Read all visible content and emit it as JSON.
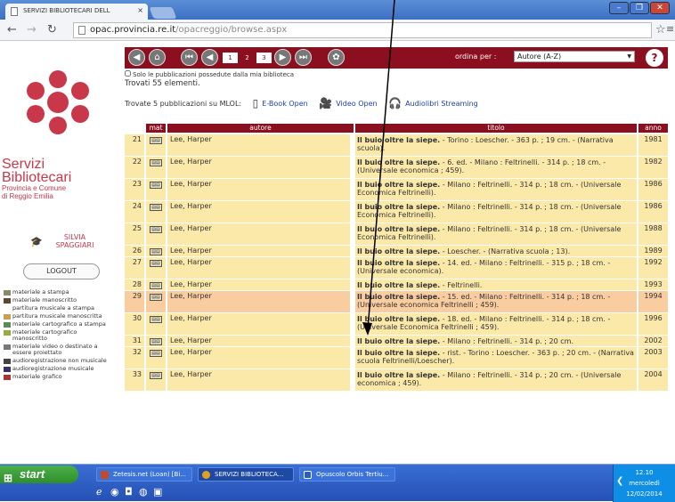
{
  "browser": {
    "tab_title": "SERVIZI BIBLIOTECARI DELL",
    "tab_close": "×",
    "url_host": "opac.provincia.re.it",
    "url_path": "/opacreggio/browse.aspx",
    "win_buttons": [
      "–",
      "❐",
      "✕"
    ]
  },
  "brand": {
    "line1": "Servizi",
    "line2": "Bibliotecari",
    "line3": "Provincia e Comune",
    "line4": "di Reggio Emilia"
  },
  "user": {
    "name1": "SILVIA",
    "name2": "SPAGGIARI",
    "logout": "LOGOUT"
  },
  "legend": [
    "materiale a stampa",
    "materiale manoscritto",
    "partitura musicale a stampa",
    "partitura musicale manoscritta",
    "materiale cartografico a stampa",
    "materiale cartografico manoscritto",
    "materiale video o destinato a essere proiettato",
    "audioregistrazione non musicale",
    "audioregistrazione musicale",
    "materiale grafico"
  ],
  "toolbar": {
    "pages": [
      "1",
      "2",
      "3"
    ],
    "current_page": "2",
    "order_label": "ordina per :",
    "order_value": "Autore (A-Z)",
    "help": "?"
  },
  "filter_text": "Solo le pubblicazioni possedute dalla mia biblioteca",
  "found_text": "Trovati 55 elementi.",
  "mlol": {
    "label": "Trovate 5 pubblicazioni su MLOL:",
    "ebook": "E-Book Open",
    "video": "Video Open",
    "audio": "Audiolibri Streaming"
  },
  "table": {
    "headers": {
      "mat": "mat",
      "autore": "autore",
      "titolo": "titolo",
      "anno": "anno"
    },
    "rows": [
      {
        "n": "21",
        "autore": "Lee, Harper",
        "titolo_b": "Il buio oltre la siepe.",
        "titolo_r": " - Torino : Loescher. - 363 p. ; 19 cm. - (Narrativa scuola).",
        "anno": "1981"
      },
      {
        "n": "22",
        "autore": "Lee, Harper",
        "titolo_b": "Il buio oltre la siepe.",
        "titolo_r": " - 6. ed. - Milano : Feltrinelli. - 314 p. ; 18 cm. - (Universale economica ; 459).",
        "anno": "1982"
      },
      {
        "n": "23",
        "autore": "Lee, Harper",
        "titolo_b": "Il buio oltre la siepe.",
        "titolo_r": " - Milano : Feltrinelli. - 314 p. ; 18 cm. - (Universale Economica Feltrinelli).",
        "anno": "1986"
      },
      {
        "n": "24",
        "autore": "Lee, Harper",
        "titolo_b": "Il buio oltre la siepe.",
        "titolo_r": " - Milano : Feltrinelli. - 314 p. ; 18 cm. - (Universale Economica Feltrinelli).",
        "anno": "1986"
      },
      {
        "n": "25",
        "autore": "Lee, Harper",
        "titolo_b": "Il buio oltre la siepe.",
        "titolo_r": " - Milano : Feltrinelli. - 314 p. ; 18 cm. - (Universale Economica Feltrinelli).",
        "anno": "1988"
      },
      {
        "n": "26",
        "autore": "Lee, Harper",
        "titolo_b": "Il buio oltre la siepe.",
        "titolo_r": " - Loescher. - (Narrativa scuola ; 13).",
        "anno": "1989"
      },
      {
        "n": "27",
        "autore": "Lee, Harper",
        "titolo_b": "Il buio oltre la siepe.",
        "titolo_r": " - 14. ed. - Milano : Feltrinelli. - 315 p. ; 18 cm. - (Universale economica).",
        "anno": "1992"
      },
      {
        "n": "28",
        "autore": "Lee, Harper",
        "titolo_b": "Il buio oltre la siepe.",
        "titolo_r": " - Feltrinelli.",
        "anno": "1993"
      },
      {
        "n": "29",
        "autore": "Lee, Harper",
        "titolo_b": "Il buio oltre la siepe.",
        "titolo_r": " - 15. ed. - Milano : Feltrinelli. - 314 p. ; 18 cm. - (Universale economica Feltrinelli ; 459).",
        "anno": "1994"
      },
      {
        "n": "30",
        "autore": "Lee, Harper",
        "titolo_b": "Il buio oltre la siepe.",
        "titolo_r": " - 18. ed. - Milano : Feltrinelli. - 314 p. ; 18 cm. - (Universale Economica Feltrinelli ; 459).",
        "anno": "1996"
      },
      {
        "n": "31",
        "autore": "Lee, Harper",
        "titolo_b": "Il buio oltre la siepe.",
        "titolo_r": " - Milano : Feltrinelli. - 314 p. ; 20 cm.",
        "anno": "2002"
      },
      {
        "n": "32",
        "autore": "Lee, Harper",
        "titolo_b": "Il buio oltre la siepe.",
        "titolo_r": " - rist. - Torino : Loescher. - 363 p. ; 20 cm. - (Narrativa scuola Feltrinelli/Loescher).",
        "anno": "2003"
      },
      {
        "n": "33",
        "autore": "Lee, Harper",
        "titolo_b": "Il buio oltre la siepe.",
        "titolo_r": " - Milano : Feltrinelli. - 314 p. ; 20 cm. - (Universale economica ; 459).",
        "anno": "2004"
      }
    ]
  },
  "taskbar": {
    "start": "start",
    "items": [
      "Zetesis.net (Loan) [Bi...",
      "SERVIZI BIBLIOTECA...",
      "Opuscolo Orbis Tertiu..."
    ],
    "time": "12.10",
    "day": "mercoledì",
    "date": "12/02/2014"
  },
  "colors": {
    "accent": "#8b0f1e",
    "brand": "#c8374a",
    "row": "#fbe9a9",
    "row_highlight": "#f9cd9f"
  }
}
